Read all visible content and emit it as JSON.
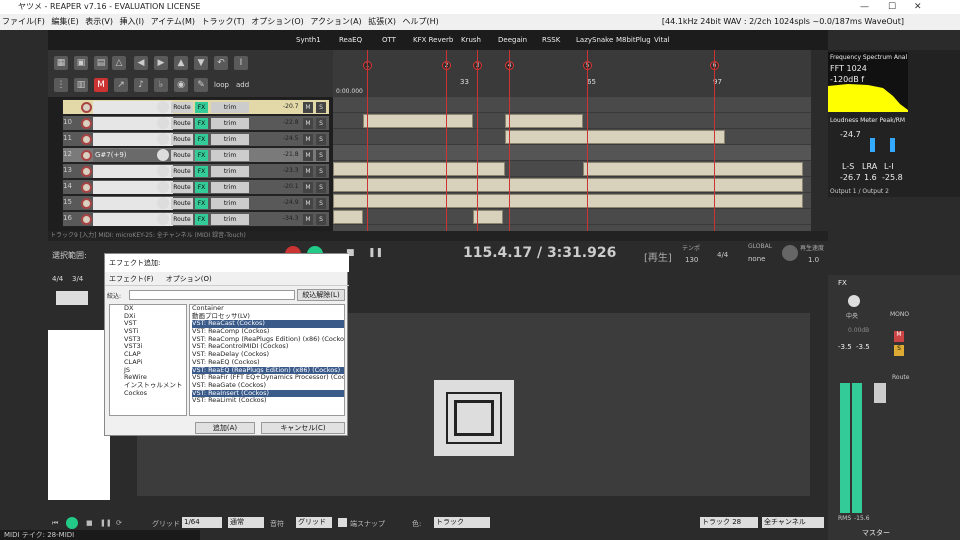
{
  "window": {
    "title": "ヤツメ - REAPER v7.16 - EVALUATION LICENSE"
  },
  "menu": {
    "items": [
      "ファイル(F)",
      "編集(E)",
      "表示(V)",
      "挿入(I)",
      "アイテム(M)",
      "トラック(T)",
      "オプション(O)",
      "アクション(A)",
      "拡張(X)",
      "ヘルプ(H)"
    ],
    "status": "[44.1kHz 24bit WAV : 2/2ch 1024spls ~0.0/187ms WaveOut]"
  },
  "fx_strip": [
    "Synth1",
    "ReaEQ",
    "OTT",
    "KFX Reverb",
    "Krush",
    "Deegain",
    "RSSK",
    "LazySnake",
    "M8bitPlug",
    "Vital"
  ],
  "toolbar": {
    "loop_label": "loop",
    "add_label": "add"
  },
  "ruler": {
    "markers": [
      "1",
      "2",
      "3",
      "4",
      "5",
      "6"
    ],
    "bar_labels": [
      "33",
      "65",
      "97"
    ],
    "time_label": "0:00.000"
  },
  "tracks": [
    {
      "num": "",
      "name": "",
      "db": "-20.7"
    },
    {
      "num": "10",
      "name": "",
      "db": "-22.8"
    },
    {
      "num": "11",
      "name": "",
      "db": "-24.5"
    },
    {
      "num": "12",
      "name": "G#7(+9)",
      "db": "-21.8"
    },
    {
      "num": "13",
      "name": "",
      "db": "-23.3"
    },
    {
      "num": "14",
      "name": "",
      "db": "-20.1"
    },
    {
      "num": "15",
      "name": "",
      "db": "-24.9"
    },
    {
      "num": "16",
      "name": "",
      "db": "-34.3"
    }
  ],
  "track_buttons": {
    "route": "Route",
    "fx": "FX",
    "trim": "trim",
    "m": "M",
    "s": "S"
  },
  "status_row": "トラック9 [入力] MIDI: microKEY-25: 全チャンネル (MIDI 録音-Touch)",
  "transport": {
    "position": "115.4.17 / 3:31.926",
    "state": "[再生]",
    "tempo_label": "テンポ",
    "tempo": "130",
    "sig": "4/4",
    "global_label": "GLOBAL",
    "global_value": "none",
    "rate_label": "再生速度",
    "rate": "1.0",
    "select_label": "選択範囲:"
  },
  "right_panel": {
    "analyzer_title": "Frequency Spectrum Anal",
    "analyzer_fft": "FFT 1024",
    "analyzer_range": "-120dB f",
    "loudness_title": "Loudness Meter Peak/RM",
    "loudness_value": "-24.7",
    "ls_label": "L-S",
    "lra_label": "LRA",
    "li_label": "L-I",
    "ls": "-26.7",
    "lra": "1.6",
    "li": "-25.8",
    "output": "Output 1 / Output 2"
  },
  "mixer": {
    "fx": "FX",
    "center": "中央",
    "db": "0.00dB",
    "mono": "MONO",
    "peak_l": "-3.5",
    "peak_r": "-3.5",
    "route": "Route",
    "rms_label": "RMS",
    "rms": "-15.6",
    "master": "マスター",
    "scale": [
      "0",
      "6",
      "12",
      "18",
      "24",
      "30",
      "36",
      "42"
    ]
  },
  "dialog": {
    "title": "エフェクト追加:",
    "menu_fx": "エフェクト(F)",
    "menu_opt": "オプション(O)",
    "filter_label": "絞込:",
    "filter_clear": "絞込解除(L)",
    "tree": [
      "DX",
      "DXi",
      "VST",
      "VSTi",
      "VST3",
      "VST3i",
      "CLAP",
      "CLAPi",
      "JS",
      "ReWire",
      "インストゥルメント",
      "Cockos"
    ],
    "items": [
      "Container",
      "動画プロセッサ(LV)",
      "VST: ReaCast (Cockos)",
      "VST: ReaComp (Cockos)",
      "VST: ReaComp (ReaPlugs Edition) (x86) (Cockos)",
      "VST: ReaControlMIDI (Cockos)",
      "VST: ReaDelay (Cockos)",
      "VST: ReaEQ (Cockos)",
      "VST: ReaEQ (ReaPlugs Edition) (x86) (Cockos)",
      "VST: ReaFir (FFT EQ+Dynamics Processor) (Cockos)",
      "VST: ReaGate (Cockos)",
      "VST: ReaInsert (Cockos)",
      "VST: ReaLimit (Cockos)"
    ],
    "add": "追加(A)",
    "cancel": "キャンセル(C)"
  },
  "midi_editor": {
    "sig1": "4/4",
    "sig2": "3/4",
    "grid_label": "グリッド",
    "grid_value": "1/64",
    "mode": "通常",
    "note_label": "音符",
    "note_value": "グリッド",
    "snap_label": "端スナップ",
    "color_label": "色:",
    "color_value": "トラック",
    "track_sel": "トラック 28",
    "channel_sel": "全チャンネル",
    "status": "MIDI テイク: 28-MIDI"
  }
}
